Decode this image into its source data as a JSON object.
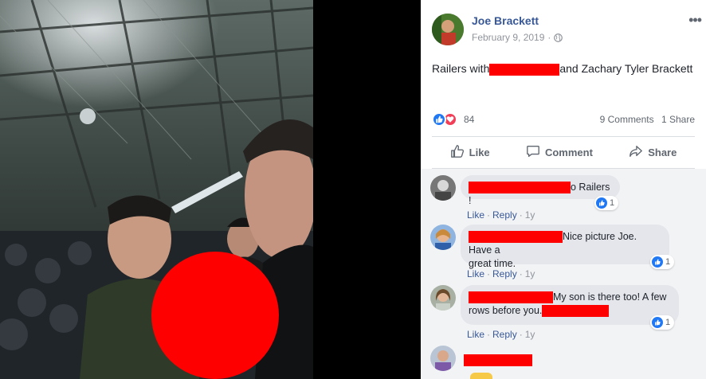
{
  "post": {
    "author": "Joe Brackett",
    "date": "February 9, 2019",
    "separator": "·",
    "text_before": "Railers with",
    "text_after": "and Zachary Tyler Brackett",
    "reaction_count": "84",
    "comments_count": "9 Comments",
    "shares_count": "1 Share"
  },
  "actions": {
    "like": "Like",
    "comment": "Comment",
    "share": "Share"
  },
  "comments": [
    {
      "text": "o Railers !",
      "likes": "1",
      "links": {
        "like": "Like",
        "reply": "Reply",
        "age": "1y"
      }
    },
    {
      "text_line1": "Nice picture Joe. Have a",
      "text_line2": "great time.",
      "likes": "1",
      "links": {
        "like": "Like",
        "reply": "Reply",
        "age": "1y"
      }
    },
    {
      "text_line1": "My son is there too! A few",
      "text_line2": "rows before you.",
      "likes": "1",
      "links": {
        "like": "Like",
        "reply": "Reply",
        "age": "1y"
      }
    }
  ],
  "colors": {
    "link": "#385898",
    "muted": "#90949c",
    "redaction": "#ff0000",
    "like_blue": "#2078f4",
    "love_red": "#f33e58"
  },
  "icons": [
    "globe-icon",
    "more-icon",
    "like-reaction-icon",
    "love-reaction-icon",
    "thumbs-up-icon",
    "comment-icon",
    "share-icon"
  ]
}
